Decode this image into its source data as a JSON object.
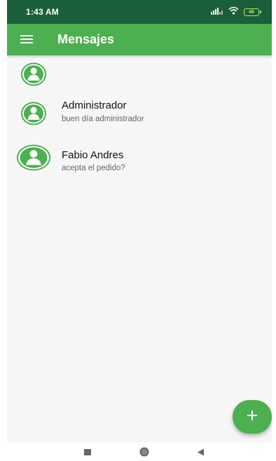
{
  "status_bar": {
    "time": "1:43 AM",
    "battery_level": "46"
  },
  "app_bar": {
    "title": "Mensajes"
  },
  "messages": [
    {
      "name": "",
      "preview": ""
    },
    {
      "name": "Administrador",
      "preview": "buen día administrador"
    },
    {
      "name": "Fabio Andres",
      "preview": "acepta el pedido?"
    }
  ],
  "colors": {
    "primary": "#4caf50",
    "status_bar": "#1b5e3a",
    "background": "#f6f6f6",
    "battery": "#b6e35a"
  },
  "icons": {
    "menu": "menu-icon",
    "avatar": "user-avatar-icon",
    "fab": "plus-icon",
    "nav_recents": "square-icon",
    "nav_home": "circle-icon",
    "nav_back": "back-triangle-icon"
  }
}
